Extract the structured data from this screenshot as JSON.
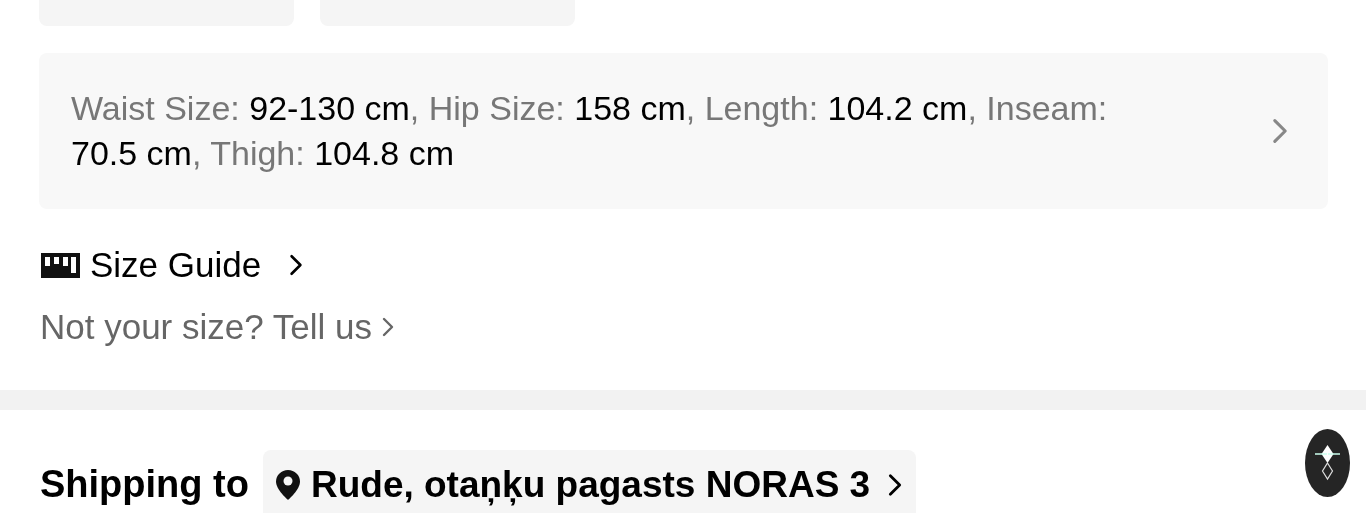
{
  "size_options": [
    {
      "kind": "option"
    },
    {
      "kind": "option"
    }
  ],
  "measurements": {
    "text": "Waist Size: **92-130 cm**, Hip Size: **158 cm**, Length: **104.2 cm**, Inseam: **70.5 cm**, Thigh: **104.8 cm**"
  },
  "size_guide": {
    "label": "Size Guide"
  },
  "feedback_link": {
    "label": "Not your size? Tell us"
  },
  "shipping": {
    "title": "Shipping to",
    "address": "Rude, otaņķu pagasts NORAS 3"
  }
}
